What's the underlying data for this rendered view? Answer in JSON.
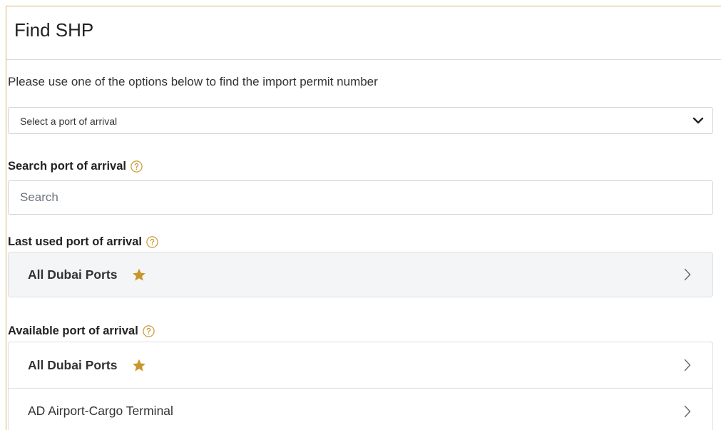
{
  "panel": {
    "title": "Find SHP"
  },
  "intro_text": "Please use one of the options below to find the import permit number",
  "port_select": {
    "selected": "Select a port of arrival"
  },
  "search_section": {
    "label": "Search port of arrival",
    "placeholder": "Search"
  },
  "last_used_section": {
    "label": "Last used port of arrival",
    "items": [
      {
        "name": "All Dubai Ports",
        "favorite": true
      }
    ]
  },
  "available_section": {
    "label": "Available port of arrival",
    "items": [
      {
        "name": "All Dubai Ports",
        "favorite": true
      },
      {
        "name": "AD Airport-Cargo Terminal",
        "favorite": false
      }
    ]
  },
  "colors": {
    "accent_gold": "#c9962b",
    "border": "#dcdfe3",
    "row_highlight": "#f4f5f7"
  },
  "icons": {
    "help": "question-circle-icon",
    "favorite": "star-icon",
    "dropdown": "chevron-down-icon",
    "row_arrow": "chevron-right-icon"
  }
}
